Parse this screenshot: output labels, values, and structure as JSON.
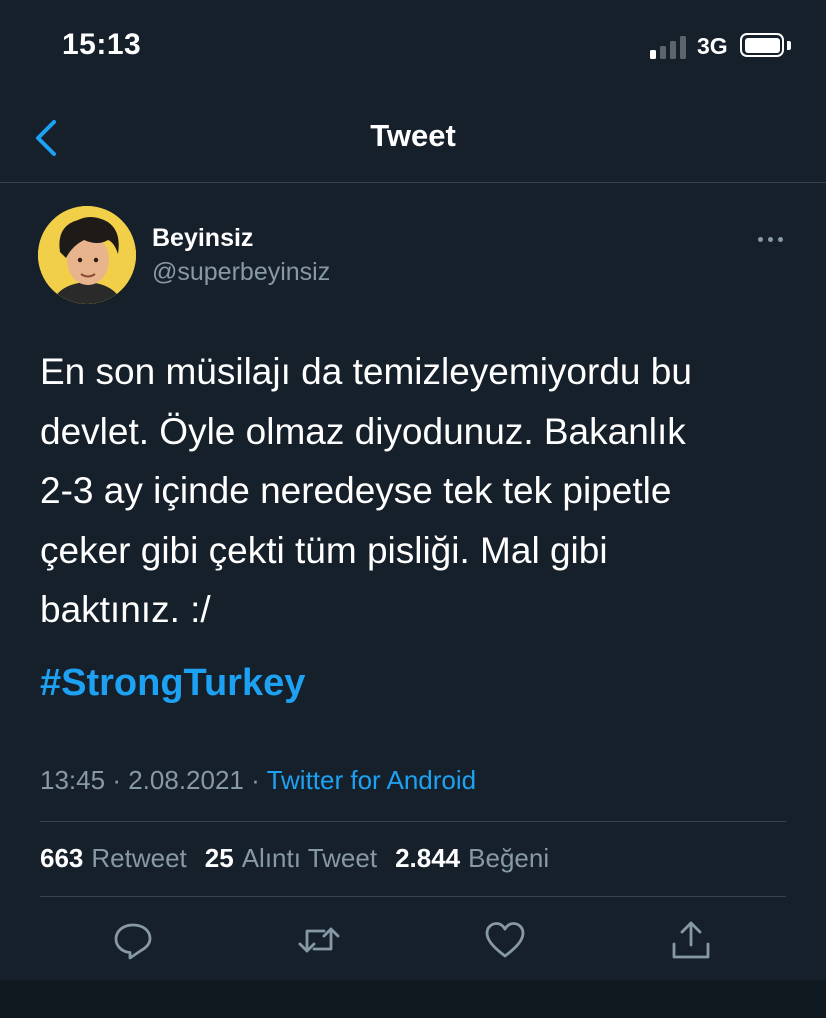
{
  "status_bar": {
    "time": "15:13",
    "network": "3G",
    "signal_bars_active": 1,
    "signal_bars_total": 4
  },
  "nav": {
    "title": "Tweet",
    "back_icon": "chevron-left-icon"
  },
  "tweet": {
    "author_name": "Beyinsiz",
    "author_handle": "@superbeyinsiz",
    "text": "En son müsilajı da temizleyemiyordu bu\ndevlet. Öyle olmaz diyodunuz. Bakanlık\n2-3 ay içinde neredeyse tek tek pipetle\nçeker gibi çekti tüm pisliği. Mal gibi\nbaktınız. :/",
    "hashtag": "#StrongTurkey",
    "time": "13:45",
    "date": "2.08.2021",
    "separator": "·",
    "source": "Twitter for Android"
  },
  "stats": {
    "retweet_count": "663",
    "retweet_label": "Retweet",
    "quote_count": "25",
    "quote_label": "Alıntı Tweet",
    "like_count": "2.844",
    "like_label": "Beğeni"
  },
  "actions": [
    "reply-icon",
    "retweet-icon",
    "like-icon",
    "share-icon"
  ],
  "colors": {
    "background": "#16202b",
    "accent": "#1da1f2",
    "secondary_text": "#8899a6",
    "divider": "#38444d"
  }
}
